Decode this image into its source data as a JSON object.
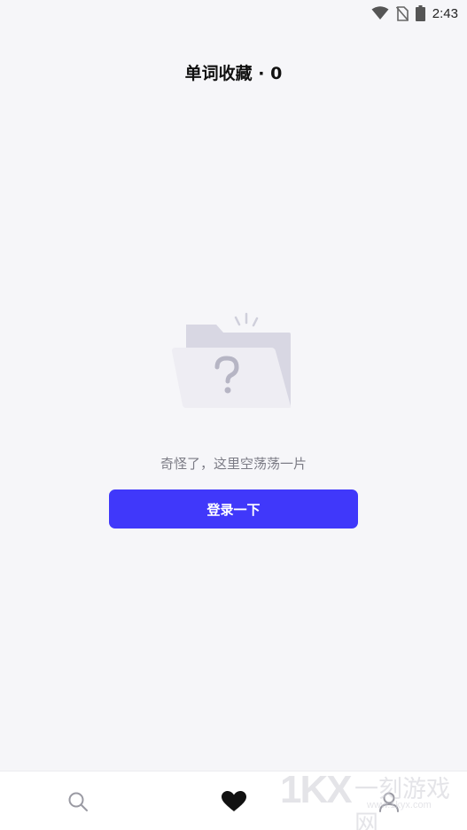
{
  "status_bar": {
    "time": "2:43"
  },
  "header": {
    "title": "单词收藏 · 0"
  },
  "empty_state": {
    "message": "奇怪了，这里空荡荡一片",
    "button_label": "登录一下"
  },
  "bottom_nav": {
    "items": [
      {
        "icon": "search-icon",
        "active": false
      },
      {
        "icon": "heart-icon",
        "active": true
      },
      {
        "icon": "person-icon",
        "active": false
      }
    ]
  },
  "watermark": {
    "logo": "1KX",
    "name": "一刻游戏网",
    "url": "www.1kyx.com"
  },
  "colors": {
    "accent": "#4038fa",
    "background": "#f6f6f9",
    "muted_text": "#7b7b85"
  }
}
